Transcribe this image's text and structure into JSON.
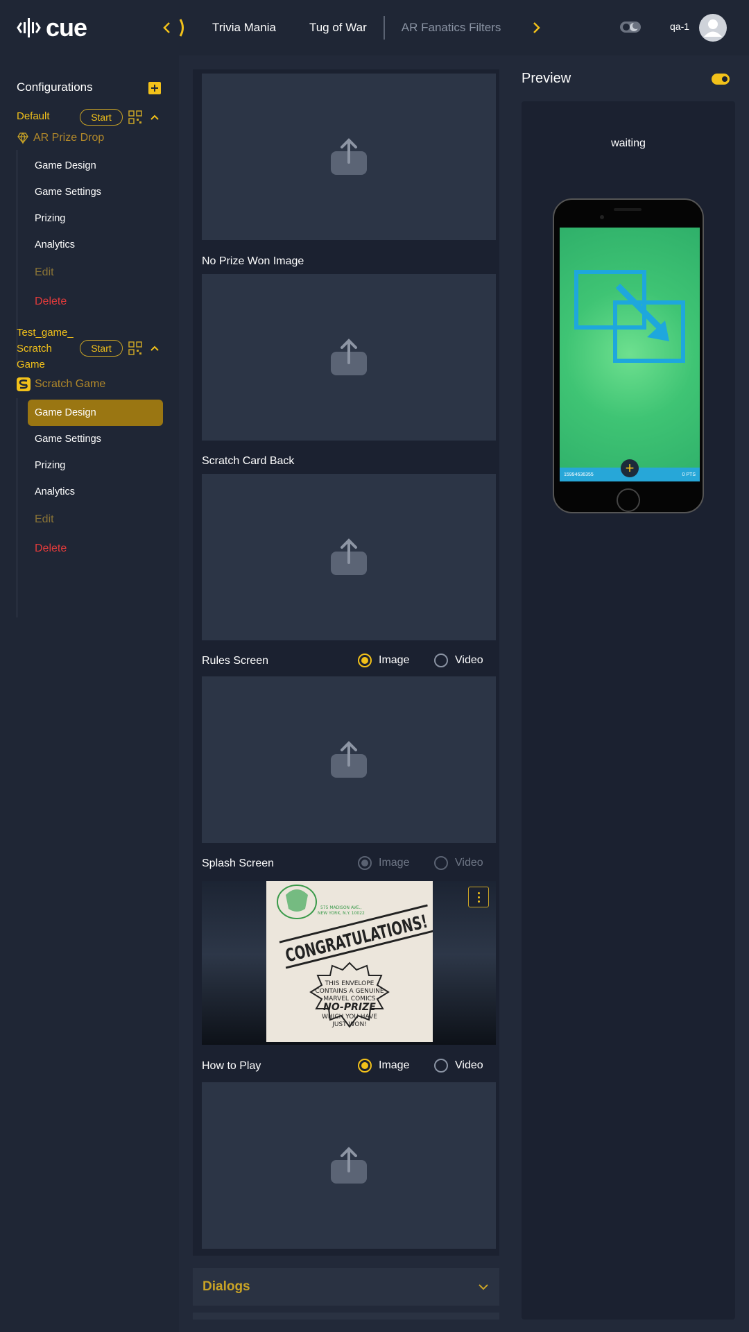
{
  "header": {
    "logo_text": "cue",
    "tabs": [
      {
        "label": "Trivia Mania"
      },
      {
        "label": "Tug of War"
      },
      {
        "label": "AR Fanatics Filters"
      }
    ],
    "user_name": "qa-1",
    "accent": "#f2c11a"
  },
  "sidebar": {
    "title": "Configurations",
    "configs": [
      {
        "name": "Default",
        "start_label": "Start",
        "game_type": "AR Prize Drop",
        "items": [
          {
            "label": "Game Design"
          },
          {
            "label": "Game Settings"
          },
          {
            "label": "Prizing"
          },
          {
            "label": "Analytics"
          },
          {
            "label": "Edit"
          },
          {
            "label": "Delete"
          }
        ]
      },
      {
        "name_lines": [
          "Test_game_",
          "Scratch",
          "Game"
        ],
        "start_label": "Start",
        "game_type": "Scratch Game",
        "items": [
          {
            "label": "Game Design",
            "active": true
          },
          {
            "label": "Game Settings"
          },
          {
            "label": "Prizing"
          },
          {
            "label": "Analytics"
          },
          {
            "label": "Edit"
          },
          {
            "label": "Delete"
          }
        ]
      }
    ]
  },
  "main": {
    "assets": {
      "no_prize": {
        "label": "No Prize Won Image"
      },
      "scratch_back": {
        "label": "Scratch Card Back"
      },
      "rules": {
        "label": "Rules Screen",
        "options": [
          "Image",
          "Video"
        ],
        "selected": "Image"
      },
      "splash": {
        "label": "Splash Screen",
        "options": [
          "Image",
          "Video"
        ],
        "selected": "Image",
        "disabled": true
      },
      "how_to_play": {
        "label": "How to Play",
        "options": [
          "Image",
          "Video"
        ],
        "selected": "Image"
      }
    },
    "splash_image_text": {
      "address1": "575 MADISON AVE.,",
      "address2": "NEW YORK, N.Y. 10022",
      "headline": "CONGRATULATIONS!",
      "line1": "THIS ENVELOPE",
      "line2": "CONTAINS A GENUINE",
      "line3": "MARVEL COMICS",
      "line4": "NO-PRIZE",
      "line5": "WHICH YOU HAVE",
      "line6": "JUST WON!"
    },
    "dialogs_label": "Dialogs"
  },
  "preview": {
    "title": "Preview",
    "status": "waiting",
    "phone": {
      "left_text": "15994636355",
      "right_text": "0 PTS"
    }
  }
}
